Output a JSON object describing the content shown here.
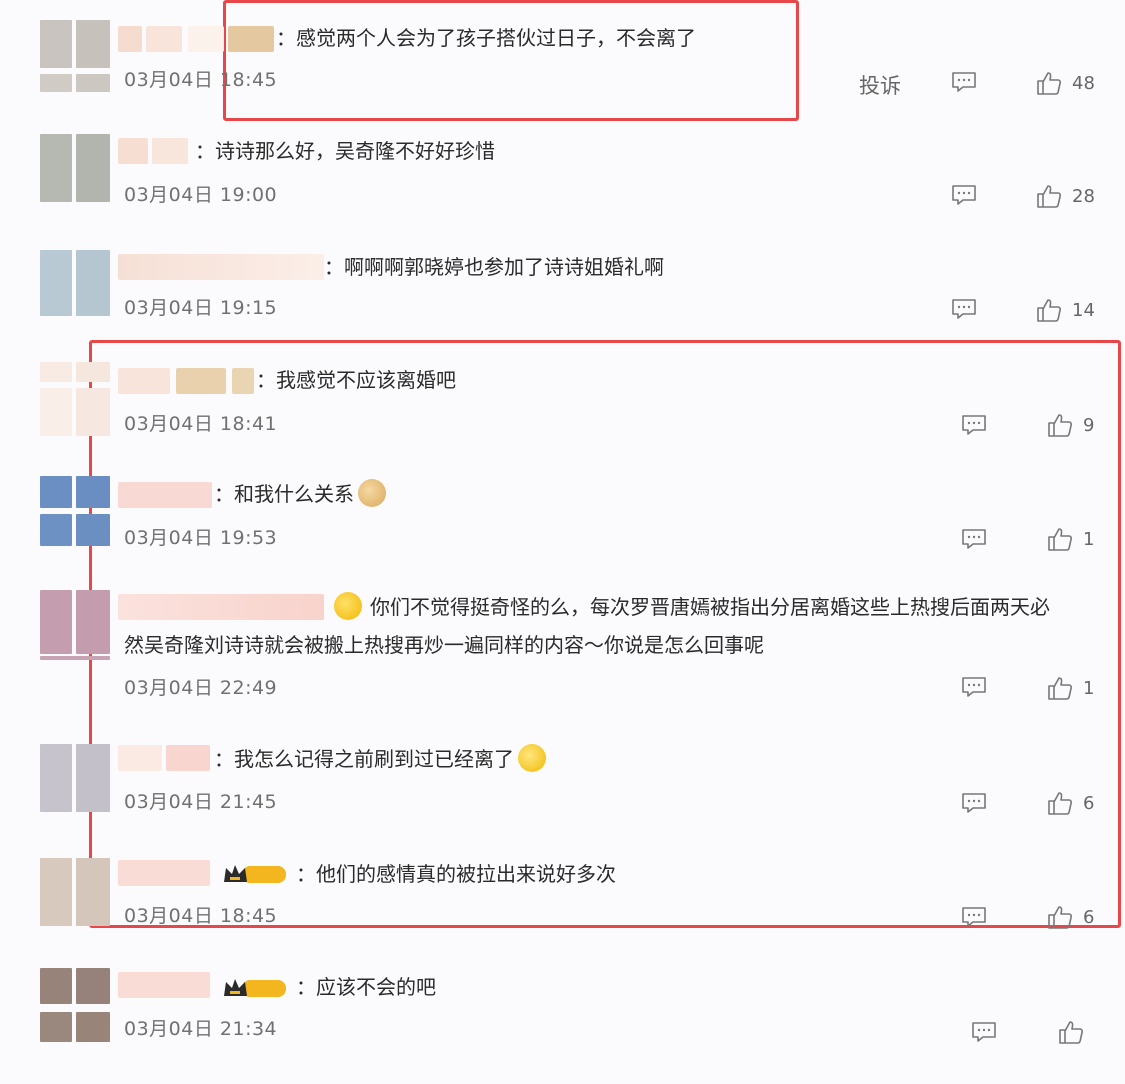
{
  "comments": [
    {
      "text": "：感觉两个人会为了孩子搭伙过日子，不会离了",
      "time": "03月04日 18:45",
      "report": "投诉",
      "likes": "48"
    },
    {
      "text": "：诗诗那么好，吴奇隆不好好珍惜",
      "time": "03月04日 19:00",
      "likes": "28"
    },
    {
      "text": "：啊啊啊郭晓婷也参加了诗诗姐婚礼啊",
      "time": "03月04日 19:15",
      "likes": "14"
    },
    {
      "text": "：我感觉不应该离婚吧",
      "time": "03月04日 18:41",
      "likes": "9"
    },
    {
      "text": "：和我什么关系",
      "time": "03月04日 19:53",
      "likes": "1"
    },
    {
      "text_line1": "你们不觉得挺奇怪的么，每次罗晋唐嫣被指出分居离婚这些上热搜后面两天必",
      "text_line2": "然吴奇隆刘诗诗就会被搬上热搜再炒一遍同样的内容～你说是怎么回事呢",
      "time": "03月04日 22:49",
      "likes": "1"
    },
    {
      "text": "：我怎么记得之前刷到过已经离了",
      "time": "03月04日 21:45",
      "likes": "6"
    },
    {
      "badge": "I",
      "text": "：他们的感情真的被拉出来说好多次",
      "time": "03月04日 18:45",
      "likes": "6"
    },
    {
      "badge": "II",
      "text": "：应该不会的吧",
      "time": "03月04日 21:34",
      "likes": ""
    }
  ],
  "colors": {
    "highlight": "#e8474a",
    "text": "#2a2a2a",
    "meta": "#707070"
  },
  "icons": {
    "reply": "comment-bubble-icon",
    "like": "thumbs-up-icon",
    "badge": "crown-badge-icon"
  }
}
